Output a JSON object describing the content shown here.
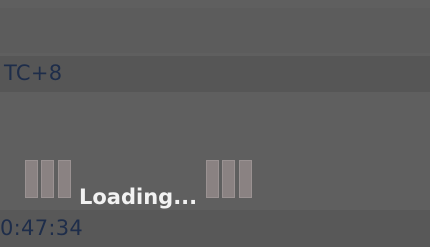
{
  "timezone": {
    "text": "TC+8"
  },
  "clock": {
    "time": "0:47:34"
  },
  "loading": {
    "label": "Loading...",
    "spinner_bar_color": "#8a8282"
  },
  "colors": {
    "panel": "#5f5f5f",
    "text_dark": "#1e2d4a",
    "text_light": "#f2f2f2"
  }
}
